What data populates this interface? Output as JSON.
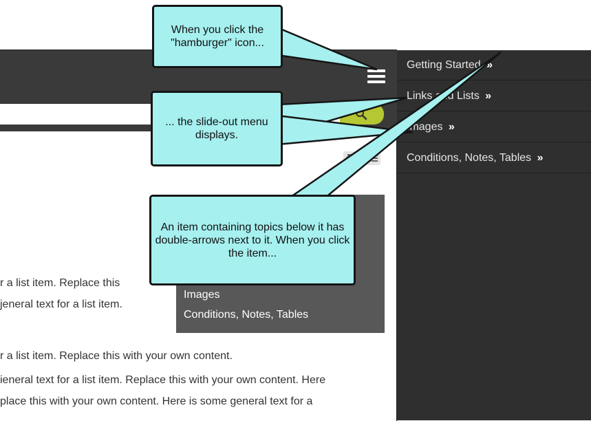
{
  "search": {
    "placeholder": ""
  },
  "menu": {
    "items": [
      {
        "label": "Getting Started",
        "arrow": "»"
      },
      {
        "label": "Links and Lists",
        "arrow": "»"
      },
      {
        "label": "Images",
        "arrow": "»"
      },
      {
        "label": "Conditions, Notes, Tables",
        "arrow": "»"
      }
    ]
  },
  "mini_toc": {
    "items": [
      "Images",
      "Conditions, Notes, Tables"
    ]
  },
  "body_lines": [
    "r a list item. Replace this",
    "jeneral text for a list item.",
    "r a list item. Replace this with your own content.",
    "ieneral text for a list item. Replace this with your own content. Here",
    "place this with your own content. Here is some general text for a"
  ],
  "callouts": {
    "hamburger": "When you click the \"hamburger\" icon...",
    "menu": "... the slide-out menu displays.",
    "item": "An item containing topics below it has double-arrows next to it. When you click the item..."
  },
  "icons": {
    "hamburger": "hamburger-icon",
    "search": "search-icon",
    "print": "print-icon",
    "toc": "list-icon"
  },
  "colors": {
    "callout_fill": "#a6f0ef",
    "search_button": "#b5c733",
    "menu_bg": "#2f2f2f",
    "header_bg": "#3a3a3a"
  }
}
